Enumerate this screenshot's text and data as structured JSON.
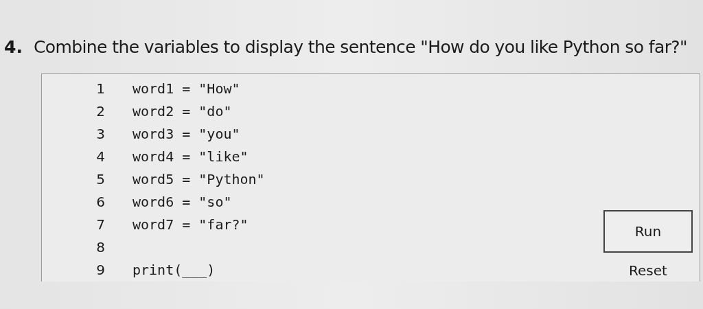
{
  "question": {
    "number": "4.",
    "text": "Combine the variables to display the sentence \"How do you like Python so far?\""
  },
  "code": {
    "lines": [
      {
        "number": "1",
        "code": "word1 = \"How\""
      },
      {
        "number": "2",
        "code": "word2 = \"do\""
      },
      {
        "number": "3",
        "code": "word3 = \"you\""
      },
      {
        "number": "4",
        "code": "word4 = \"like\""
      },
      {
        "number": "5",
        "code": "word5 = \"Python\""
      },
      {
        "number": "6",
        "code": "word6 = \"so\""
      },
      {
        "number": "7",
        "code": "word7 = \"far?\""
      },
      {
        "number": "8"
      },
      {
        "number": "9",
        "code": "print(___)"
      }
    ]
  },
  "buttons": [
    {
      "label": "Run",
      "kind": "outlined"
    },
    {
      "label": "Reset",
      "kind": "plain"
    }
  ]
}
